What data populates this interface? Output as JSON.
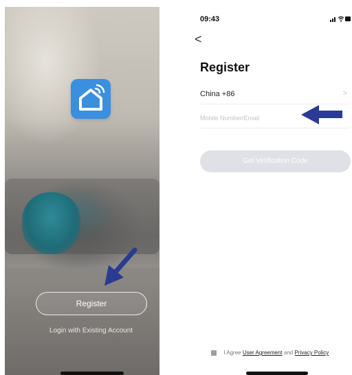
{
  "welcome_screen": {
    "register_label": "Register",
    "login_label": "Login with Existing Account",
    "logo_icon": "smart-home-logo-icon"
  },
  "register_screen": {
    "status_time": "09:43",
    "back_label": "<",
    "title": "Register",
    "country_value": "China +86",
    "country_chevron": ">",
    "phone_placeholder": "Mobile Number/Email",
    "verify_label": "Get Verification Code",
    "agree": {
      "prefix": "I Agree",
      "user_agreement": "User Agreement",
      "and": "and",
      "privacy_policy": "Privacy Policy"
    }
  },
  "colors": {
    "logo_blue": "#3a8fdf",
    "annotation_arrow": "#2b3a92",
    "disabled_button": "#dfe1e6"
  }
}
